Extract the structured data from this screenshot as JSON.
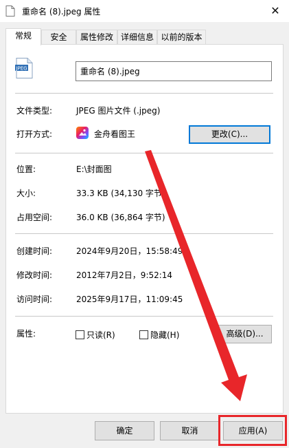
{
  "window": {
    "title": "重命名 (8).jpeg 属性",
    "close_glyph": "✕"
  },
  "tabs": [
    {
      "label": "常规",
      "active": true
    },
    {
      "label": "安全",
      "active": false
    },
    {
      "label": "属性修改",
      "active": false
    },
    {
      "label": "详细信息",
      "active": false
    },
    {
      "label": "以前的版本",
      "active": false
    }
  ],
  "general": {
    "file_icon_text": "JPEG",
    "filename": "重命名 (8).jpeg",
    "file_type_label": "文件类型:",
    "file_type_value": "JPEG 图片文件 (.jpeg)",
    "open_with_label": "打开方式:",
    "open_with_app": "金舟看图王",
    "change_button": "更改(C)...",
    "location_label": "位置:",
    "location_value": "E:\\封面图",
    "size_label": "大小:",
    "size_value": "33.3 KB (34,130 字节)",
    "disk_size_label": "占用空间:",
    "disk_size_value": "36.0 KB (36,864 字节)",
    "created_label": "创建时间:",
    "created_value": "2024年9月20日，15:58:49",
    "modified_label": "修改时间:",
    "modified_value": "2012年7月2日，9:52:14",
    "accessed_label": "访问时间:",
    "accessed_value": "2025年9月17日，11:09:45",
    "attributes_label": "属性:",
    "readonly_label": "只读(R)",
    "readonly_checked": false,
    "hidden_label": "隐藏(H)",
    "hidden_checked": false,
    "advanced_button": "高级(D)..."
  },
  "footer": {
    "ok_button": "确定",
    "cancel_button": "取消",
    "apply_button": "应用(A)"
  },
  "annotation": {
    "color": "#e8262a"
  }
}
